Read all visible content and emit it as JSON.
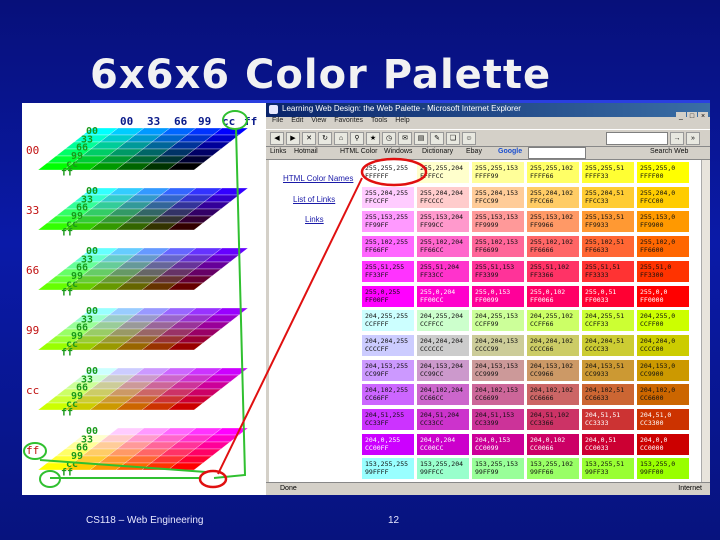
{
  "slide": {
    "title": "6x6x6 Color Palette",
    "footer_left": "CS118 – Web Engineering",
    "page_number": "12"
  },
  "cube": {
    "header_values": [
      "00",
      "33",
      "66",
      "99",
      "cc",
      "ff"
    ],
    "level_labels": [
      "00",
      "33",
      "66",
      "99",
      "cc",
      "ff"
    ],
    "stair_values": [
      "00",
      "33",
      "66",
      "99",
      "cc",
      "ff"
    ]
  },
  "browser": {
    "title": "Learning Web Design: the Web Palette - Microsoft Internet Explorer",
    "menu": [
      "File",
      "Edit",
      "View",
      "Favorites",
      "Tools",
      "Help"
    ],
    "links_bar": [
      "Links",
      "Hotmail",
      "HTML Color",
      "Windows",
      "Dictionary",
      "Ebay"
    ],
    "google_label": "Google",
    "search_label": "Search Web",
    "status_text": "Done",
    "zone_text": "Internet",
    "side_links": [
      "HTML Color Names",
      "List of Links",
      "Links"
    ]
  },
  "palette_rows": [
    [
      "255,255,255 FFFFFF",
      "255,255,204 FFFFCC",
      "255,255,153 FFFF99",
      "255,255,102 FFFF66",
      "255,255,51 FFFF33",
      "255,255,0 FFFF00"
    ],
    [
      "255,204,255 FFCCFF",
      "255,204,204 FFCCCC",
      "255,204,153 FFCC99",
      "255,204,102 FFCC66",
      "255,204,51 FFCC33",
      "255,204,0 FFCC00"
    ],
    [
      "255,153,255 FF99FF",
      "255,153,204 FF99CC",
      "255,153,153 FF9999",
      "255,153,102 FF9966",
      "255,153,51 FF9933",
      "255,153,0 FF9900"
    ],
    [
      "255,102,255 FF66FF",
      "255,102,204 FF66CC",
      "255,102,153 FF6699",
      "255,102,102 FF6666",
      "255,102,51 FF6633",
      "255,102,0 FF6600"
    ],
    [
      "255,51,255 FF33FF",
      "255,51,204 FF33CC",
      "255,51,153 FF3399",
      "255,51,102 FF3366",
      "255,51,51 FF3333",
      "255,51,0 FF3300"
    ],
    [
      "255,0,255 FF00FF",
      "255,0,204 FF00CC",
      "255,0,153 FF0099",
      "255,0,102 FF0066",
      "255,0,51 FF0033",
      "255,0,0 FF0000"
    ],
    [
      "204,255,255 CCFFFF",
      "204,255,204 CCFFCC",
      "204,255,153 CCFF99",
      "204,255,102 CCFF66",
      "204,255,51 CCFF33",
      "204,255,0 CCFF00"
    ],
    [
      "204,204,255 CCCCFF",
      "204,204,204 CCCCCC",
      "204,204,153 CCCC99",
      "204,204,102 CCCC66",
      "204,204,51 CCCC33",
      "204,204,0 CCCC00"
    ],
    [
      "204,153,255 CC99FF",
      "204,153,204 CC99CC",
      "204,153,153 CC9999",
      "204,153,102 CC9966",
      "204,153,51 CC9933",
      "204,153,0 CC9900"
    ],
    [
      "204,102,255 CC66FF",
      "204,102,204 CC66CC",
      "204,102,153 CC6699",
      "204,102,102 CC6666",
      "204,102,51 CC6633",
      "204,102,0 CC6600"
    ],
    [
      "204,51,255 CC33FF",
      "204,51,204 CC33CC",
      "204,51,153 CC3399",
      "204,51,102 CC3366",
      "204,51,51 CC3333",
      "204,51,0 CC3300"
    ],
    [
      "204,0,255 CC00FF",
      "204,0,204 CC00CC",
      "204,0,153 CC0099",
      "204,0,102 CC0066",
      "204,0,51 CC0033",
      "204,0,0 CC0000"
    ],
    [
      "153,255,255 99FFFF",
      "153,255,204 99FFCC",
      "153,255,153 99FF99",
      "153,255,102 99FF66",
      "153,255,51 99FF33",
      "153,255,0 99FF00"
    ]
  ],
  "colors": {
    "highlight": "#e01010",
    "connector": "#30c030"
  }
}
